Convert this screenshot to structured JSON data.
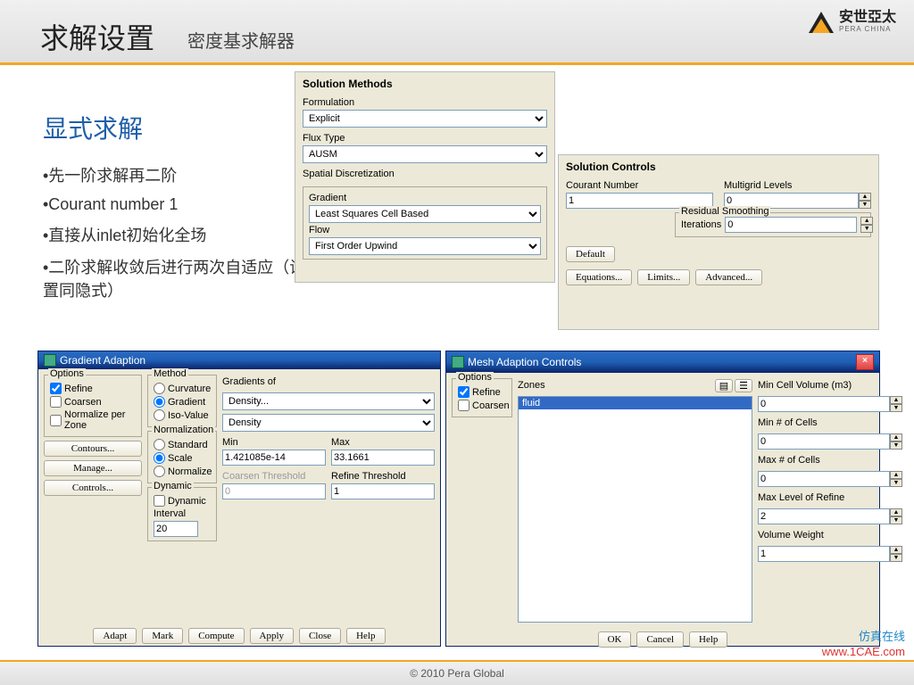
{
  "header": {
    "title": "求解设置",
    "subtitle": "密度基求解器",
    "brand": "安世亞太",
    "brand_sub": "PERA CHINA"
  },
  "left": {
    "heading": "显式求解",
    "bullets": [
      "•先一阶求解再二阶",
      "•Courant number 1",
      "•直接从inlet初始化全场",
      "•二阶求解收敛后进行两次自适应（设置同隐式）"
    ]
  },
  "sm": {
    "title": "Solution Methods",
    "formulation_lbl": "Formulation",
    "formulation_val": "Explicit",
    "flux_lbl": "Flux Type",
    "flux_val": "AUSM",
    "sd_lbl": "Spatial Discretization",
    "grad_lbl": "Gradient",
    "grad_val": "Least Squares Cell Based",
    "flow_lbl": "Flow",
    "flow_val": "First Order Upwind"
  },
  "sc": {
    "title": "Solution Controls",
    "courant_lbl": "Courant Number",
    "courant_val": "1",
    "mg_lbl": "Multigrid Levels",
    "mg_val": "0",
    "rs_lbl": "Residual Smoothing",
    "iter_lbl": "Iterations",
    "iter_val": "0",
    "btn_default": "Default",
    "btn_eq": "Equations...",
    "btn_lim": "Limits...",
    "btn_adv": "Advanced..."
  },
  "ga": {
    "title": "Gradient Adaption",
    "opt": "Options",
    "opt_refine": "Refine",
    "opt_coarsen": "Coarsen",
    "opt_norm": "Normalize per Zone",
    "method": "Method",
    "m_curv": "Curvature",
    "m_grad": "Gradient",
    "m_iso": "Iso-Value",
    "grads": "Gradients of",
    "g1": "Density...",
    "g2": "Density",
    "min_lbl": "Min",
    "min_val": "1.421085e-14",
    "max_lbl": "Max",
    "max_val": "33.1661",
    "ct_lbl": "Coarsen Threshold",
    "ct_val": "0",
    "rt_lbl": "Refine Threshold",
    "rt_val": "1",
    "norm": "Normalization",
    "n_std": "Standard",
    "n_scale": "Scale",
    "n_norm": "Normalize",
    "dyn": "Dynamic",
    "dyn_chk": "Dynamic",
    "int_lbl": "Interval",
    "int_val": "20",
    "btn_cont": "Contours...",
    "btn_mng": "Manage...",
    "btn_ctrl": "Controls...",
    "b_adapt": "Adapt",
    "b_mark": "Mark",
    "b_comp": "Compute",
    "b_apply": "Apply",
    "b_close": "Close",
    "b_help": "Help"
  },
  "mac": {
    "title": "Mesh Adaption Controls",
    "opt": "Options",
    "refine": "Refine",
    "coarsen": "Coarsen",
    "zones": "Zones",
    "zone_item": "fluid",
    "mcv": "Min Cell Volume (m3)",
    "mcv_v": "0",
    "mnc": "Min # of Cells",
    "mnc_v": "0",
    "mxc": "Max # of Cells",
    "mxc_v": "0",
    "mlr": "Max Level of Refine",
    "mlr_v": "2",
    "vw": "Volume Weight",
    "vw_v": "1",
    "ok": "OK",
    "cancel": "Cancel",
    "help": "Help"
  },
  "foot": "© 2010 Pera Global",
  "wm": {
    "l1": "仿真在线",
    "l2": "www.1CAE.com"
  }
}
